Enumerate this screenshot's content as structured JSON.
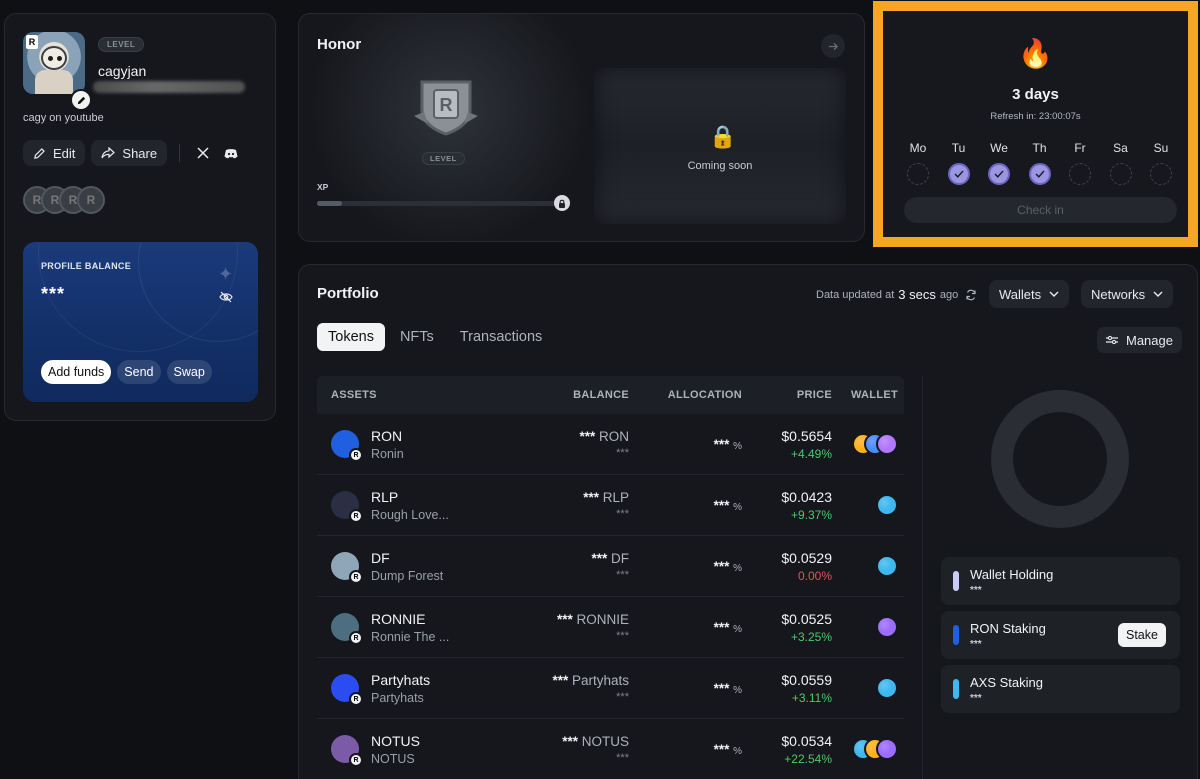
{
  "profile": {
    "level_label": "LEVEL",
    "username": "cagyjan",
    "bio": "cagy on youtube",
    "edit_label": "Edit",
    "share_label": "Share",
    "balance": {
      "label": "PROFILE BALANCE",
      "value": "***",
      "add_funds": "Add funds",
      "send": "Send",
      "swap": "Swap"
    }
  },
  "honor": {
    "title": "Honor",
    "level_label": "LEVEL",
    "xp_label": "XP",
    "coming_soon": "Coming soon"
  },
  "streak": {
    "days": "3 days",
    "refresh": "Refresh in: 23:00:07s",
    "week": [
      {
        "label": "Mo",
        "done": false
      },
      {
        "label": "Tu",
        "done": true
      },
      {
        "label": "We",
        "done": true
      },
      {
        "label": "Th",
        "done": true
      },
      {
        "label": "Fr",
        "done": false
      },
      {
        "label": "Sa",
        "done": false
      },
      {
        "label": "Su",
        "done": false
      }
    ],
    "checkin_label": "Check in"
  },
  "portfolio": {
    "title": "Portfolio",
    "updated_prefix": "Data updated at",
    "updated_value": "3 secs",
    "updated_suffix": "ago",
    "wallets_label": "Wallets",
    "networks_label": "Networks",
    "tabs": [
      "Tokens",
      "NFTs",
      "Transactions"
    ],
    "manage_label": "Manage",
    "columns": {
      "assets": "ASSETS",
      "balance": "BALANCE",
      "allocation": "ALLOCATION",
      "price": "PRICE",
      "wallet": "WALLET"
    },
    "rows": [
      {
        "name": "RON",
        "sub": "Ronin",
        "bal_stars": "***",
        "bal_sym": "RON",
        "bal_usd": "***",
        "alloc": "***",
        "alloc_unit": "%",
        "price": "$0.5654",
        "change": "+4.49%",
        "change_color": "#4cc96b",
        "icon_color": "#1f5fe0",
        "wallets": [
          "#ffb020",
          "#4a8cff",
          "#b277ff"
        ]
      },
      {
        "name": "RLP",
        "sub": "Rough Love...",
        "bal_stars": "***",
        "bal_sym": "RLP",
        "bal_usd": "***",
        "alloc": "***",
        "alloc_unit": "%",
        "price": "$0.0423",
        "change": "+9.37%",
        "change_color": "#4cc96b",
        "icon_color": "#2a2f45",
        "wallets": [
          "#3fb8f0"
        ]
      },
      {
        "name": "DF",
        "sub": "Dump Forest",
        "bal_stars": "***",
        "bal_sym": "DF",
        "bal_usd": "***",
        "alloc": "***",
        "alloc_unit": "%",
        "price": "$0.0529",
        "change": "0.00%",
        "change_color": "#e05555",
        "icon_color": "#8fa6b8",
        "wallets": [
          "#3fb8f0"
        ]
      },
      {
        "name": "RONNIE",
        "sub": "Ronnie The ...",
        "bal_stars": "***",
        "bal_sym": "RONNIE",
        "bal_usd": "***",
        "alloc": "***",
        "alloc_unit": "%",
        "price": "$0.0525",
        "change": "+3.25%",
        "change_color": "#4cc96b",
        "icon_color": "#4c6e80",
        "wallets": [
          "#9b6cff"
        ]
      },
      {
        "name": "Partyhats",
        "sub": "Partyhats",
        "bal_stars": "***",
        "bal_sym": "Partyhats",
        "bal_usd": "***",
        "alloc": "***",
        "alloc_unit": "%",
        "price": "$0.0559",
        "change": "+3.11%",
        "change_color": "#4cc96b",
        "icon_color": "#2a4cf0",
        "wallets": [
          "#3fb8f0"
        ]
      },
      {
        "name": "NOTUS",
        "sub": "NOTUS",
        "bal_stars": "***",
        "bal_sym": "NOTUS",
        "bal_usd": "***",
        "alloc": "***",
        "alloc_unit": "%",
        "price": "$0.0534",
        "change": "+22.54%",
        "change_color": "#4cc96b",
        "icon_color": "#7b5aa8",
        "wallets": [
          "#3fb8f0",
          "#ffb020",
          "#9b6cff"
        ]
      }
    ],
    "legend": [
      {
        "name": "Wallet Holding",
        "value": "***",
        "color": "#c9cdf5"
      },
      {
        "name": "RON Staking",
        "value": "***",
        "color": "#1f5fe0",
        "action": "Stake"
      },
      {
        "name": "AXS Staking",
        "value": "***",
        "color": "#3fb8f0"
      }
    ]
  }
}
